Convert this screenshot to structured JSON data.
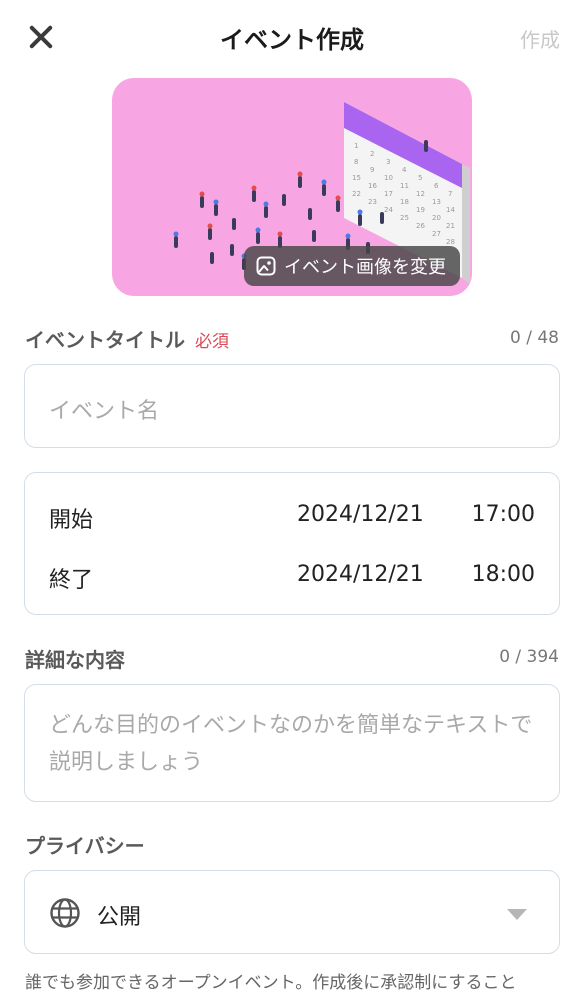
{
  "header": {
    "title": "イベント作成",
    "create_label": "作成"
  },
  "hero": {
    "change_image_label": "イベント画像を変更",
    "background_color": "#f7a6e3"
  },
  "event_title": {
    "label": "イベントタイトル",
    "required_label": "必須",
    "counter": "0 / 48",
    "placeholder": "イベント名"
  },
  "schedule": {
    "start": {
      "label": "開始",
      "date": "2024/12/21",
      "time": "17:00"
    },
    "end": {
      "label": "終了",
      "date": "2024/12/21",
      "time": "18:00"
    }
  },
  "details": {
    "label": "詳細な内容",
    "counter": "0 / 394",
    "placeholder": "どんな目的のイベントなのかを簡単なテキストで説明しましょう"
  },
  "privacy": {
    "label": "プライバシー",
    "value": "公開",
    "icon": "globe-icon",
    "note": "誰でも参加できるオープンイベント。作成後に承認制にすること"
  },
  "colors": {
    "required": "#d94b55",
    "border": "#d5dde6",
    "calendar_accent": "#a964f0"
  }
}
